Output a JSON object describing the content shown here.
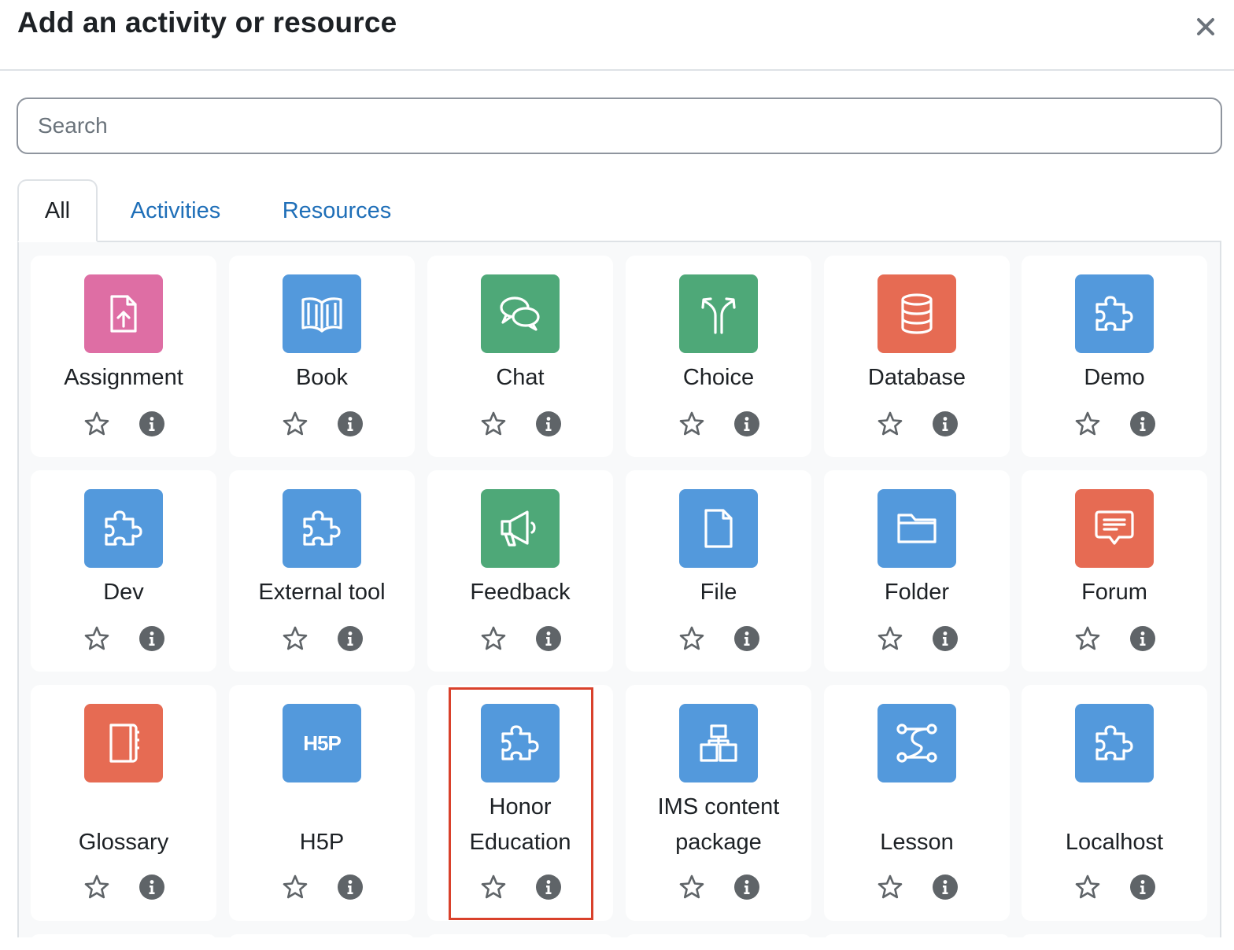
{
  "dialog": {
    "title": "Add an activity or resource",
    "close_label": "×"
  },
  "search": {
    "placeholder": "Search",
    "value": ""
  },
  "tabs": [
    {
      "label": "All",
      "active": true
    },
    {
      "label": "Activities",
      "active": false
    },
    {
      "label": "Resources",
      "active": false
    }
  ],
  "colors": {
    "pink": "#de6ea4",
    "blue": "#5399dc",
    "green": "#4ea878",
    "red": "#e66b53",
    "highlight_border": "#d9412b",
    "link": "#1f6fb8"
  },
  "items": [
    {
      "lines": [
        "Assignment"
      ],
      "icon": "assignment-upload-icon",
      "color": "pink"
    },
    {
      "lines": [
        "Book"
      ],
      "icon": "book-icon",
      "color": "blue"
    },
    {
      "lines": [
        "Chat"
      ],
      "icon": "chat-bubbles-icon",
      "color": "green"
    },
    {
      "lines": [
        "Choice"
      ],
      "icon": "choice-arrows-icon",
      "color": "green"
    },
    {
      "lines": [
        "Database"
      ],
      "icon": "database-icon",
      "color": "red"
    },
    {
      "lines": [
        "Demo"
      ],
      "icon": "puzzle-icon",
      "color": "blue"
    },
    {
      "lines": [
        "Dev"
      ],
      "icon": "puzzle-icon",
      "color": "blue"
    },
    {
      "lines": [
        "External tool"
      ],
      "icon": "puzzle-icon",
      "color": "blue"
    },
    {
      "lines": [
        "Feedback"
      ],
      "icon": "megaphone-icon",
      "color": "green"
    },
    {
      "lines": [
        "File"
      ],
      "icon": "file-icon",
      "color": "blue"
    },
    {
      "lines": [
        "Folder"
      ],
      "icon": "folder-icon",
      "color": "blue"
    },
    {
      "lines": [
        "Forum"
      ],
      "icon": "forum-icon",
      "color": "red"
    },
    {
      "lines": [
        "Glossary"
      ],
      "icon": "glossary-icon",
      "color": "red"
    },
    {
      "lines": [
        "H5P"
      ],
      "icon": "h5p-icon",
      "icon_text": "H5P",
      "color": "blue"
    },
    {
      "lines": [
        "Honor",
        "Education"
      ],
      "icon": "puzzle-icon",
      "color": "blue",
      "highlighted": true
    },
    {
      "lines": [
        "IMS content",
        "package"
      ],
      "icon": "ims-package-icon",
      "color": "blue"
    },
    {
      "lines": [
        "Lesson"
      ],
      "icon": "lesson-path-icon",
      "color": "blue"
    },
    {
      "lines": [
        "Localhost"
      ],
      "icon": "puzzle-icon",
      "color": "blue"
    }
  ]
}
